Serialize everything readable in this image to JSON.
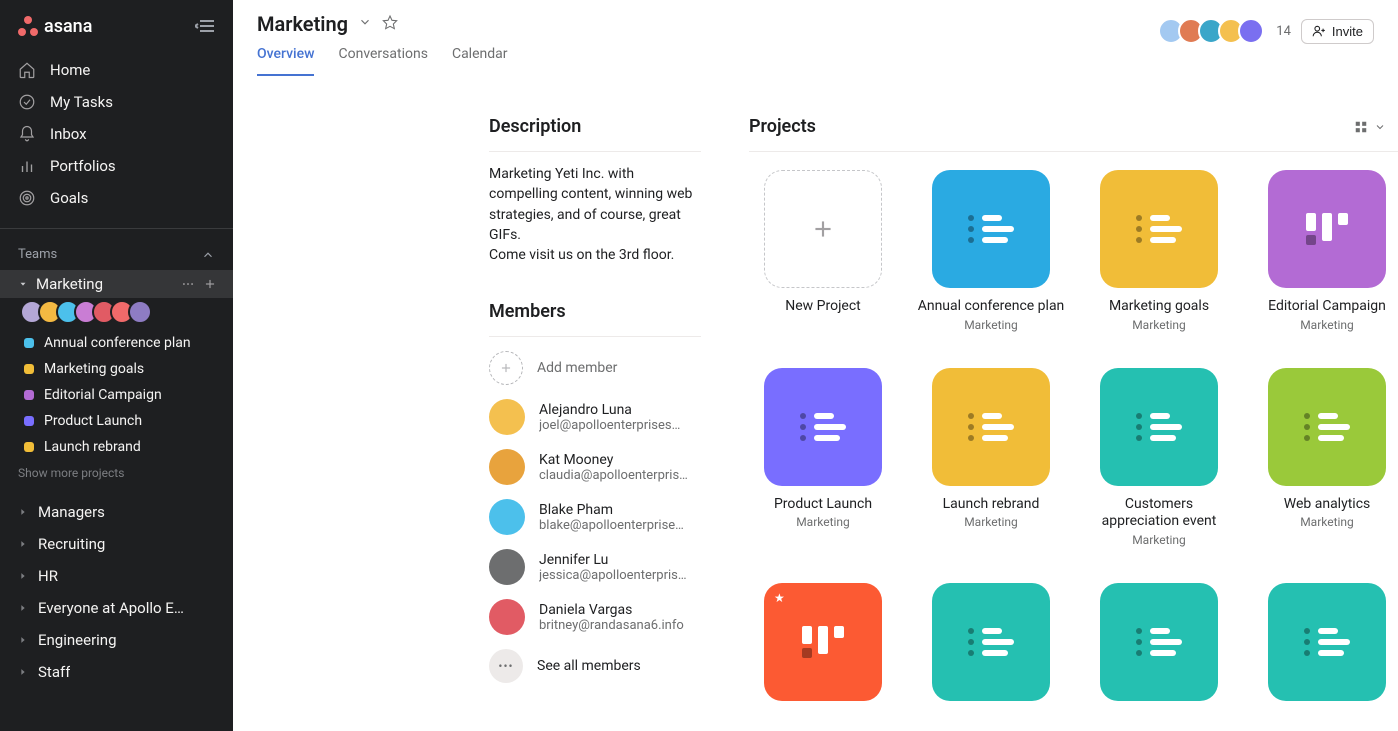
{
  "brand": "asana",
  "nav": {
    "home": "Home",
    "my_tasks": "My Tasks",
    "inbox": "Inbox",
    "portfolios": "Portfolios",
    "goals": "Goals"
  },
  "teams_header": "Teams",
  "active_team": {
    "name": "Marketing",
    "avatar_colors": [
      "#b4a7d6",
      "#f4b942",
      "#4cc0eb",
      "#c97dd4",
      "#e15b64",
      "#f06a6a",
      "#8e7cc3"
    ],
    "projects": [
      {
        "name": "Annual conference plan",
        "color": "#4cc0eb"
      },
      {
        "name": "Marketing goals",
        "color": "#f1bd38"
      },
      {
        "name": "Editorial Campaign",
        "color": "#b36bd4"
      },
      {
        "name": "Product Launch",
        "color": "#796eff"
      },
      {
        "name": "Launch rebrand",
        "color": "#f1bd38"
      }
    ],
    "show_more": "Show more projects"
  },
  "other_teams": [
    "Managers",
    "Recruiting",
    "HR",
    "Everyone at Apollo E…",
    "Engineering",
    "Staff"
  ],
  "header": {
    "title": "Marketing",
    "tabs": [
      "Overview",
      "Conversations",
      "Calendar"
    ],
    "active_tab": 0,
    "member_count": "14",
    "invite_label": "Invite",
    "avatar_colors": [
      "#a3c9f1",
      "#e07b53",
      "#3aa6c9",
      "#f4c04f",
      "#7a6ff0"
    ]
  },
  "description": {
    "title": "Description",
    "line1": "Marketing Yeti Inc. with compelling content, winning web strategies, and of course, great GIFs.",
    "line2": "Come visit us on the 3rd floor."
  },
  "members": {
    "title": "Members",
    "add_label": "Add member",
    "see_all": "See all members",
    "list": [
      {
        "name": "Alejandro Luna",
        "email": "joel@apolloenterprises…",
        "color": "#f4c04f"
      },
      {
        "name": "Kat Mooney",
        "email": "claudia@apolloenterpris…",
        "color": "#e8a33d"
      },
      {
        "name": "Blake Pham",
        "email": "blake@apolloenterprise…",
        "color": "#4cc0eb"
      },
      {
        "name": "Jennifer Lu",
        "email": "jessica@apolloenterpris…",
        "color": "#6d6e6f"
      },
      {
        "name": "Daniela Vargas",
        "email": "britney@randasana6.info",
        "color": "#e15b64"
      }
    ]
  },
  "projects": {
    "title": "Projects",
    "new_label": "New Project",
    "team_label": "Marketing",
    "items": [
      {
        "name": "Annual conference plan",
        "color": "#2aaae2",
        "glyph": "list"
      },
      {
        "name": "Marketing goals",
        "color": "#f1bd38",
        "glyph": "list"
      },
      {
        "name": "Editorial Campaign",
        "color": "#b36bd4",
        "glyph": "board"
      },
      {
        "name": "Product Launch",
        "color": "#796eff",
        "glyph": "list"
      },
      {
        "name": "Launch rebrand",
        "color": "#f1bd38",
        "glyph": "list"
      },
      {
        "name": "Customers appreciation event",
        "color": "#25c0b1",
        "glyph": "list"
      },
      {
        "name": "Web analytics",
        "color": "#9ac93a",
        "glyph": "list"
      },
      {
        "name": "",
        "color": "#fc5a33",
        "glyph": "board",
        "starred": true
      },
      {
        "name": "",
        "color": "#25c0b1",
        "glyph": "list"
      },
      {
        "name": "",
        "color": "#25c0b1",
        "glyph": "list"
      },
      {
        "name": "",
        "color": "#25c0b1",
        "glyph": "list"
      }
    ]
  }
}
